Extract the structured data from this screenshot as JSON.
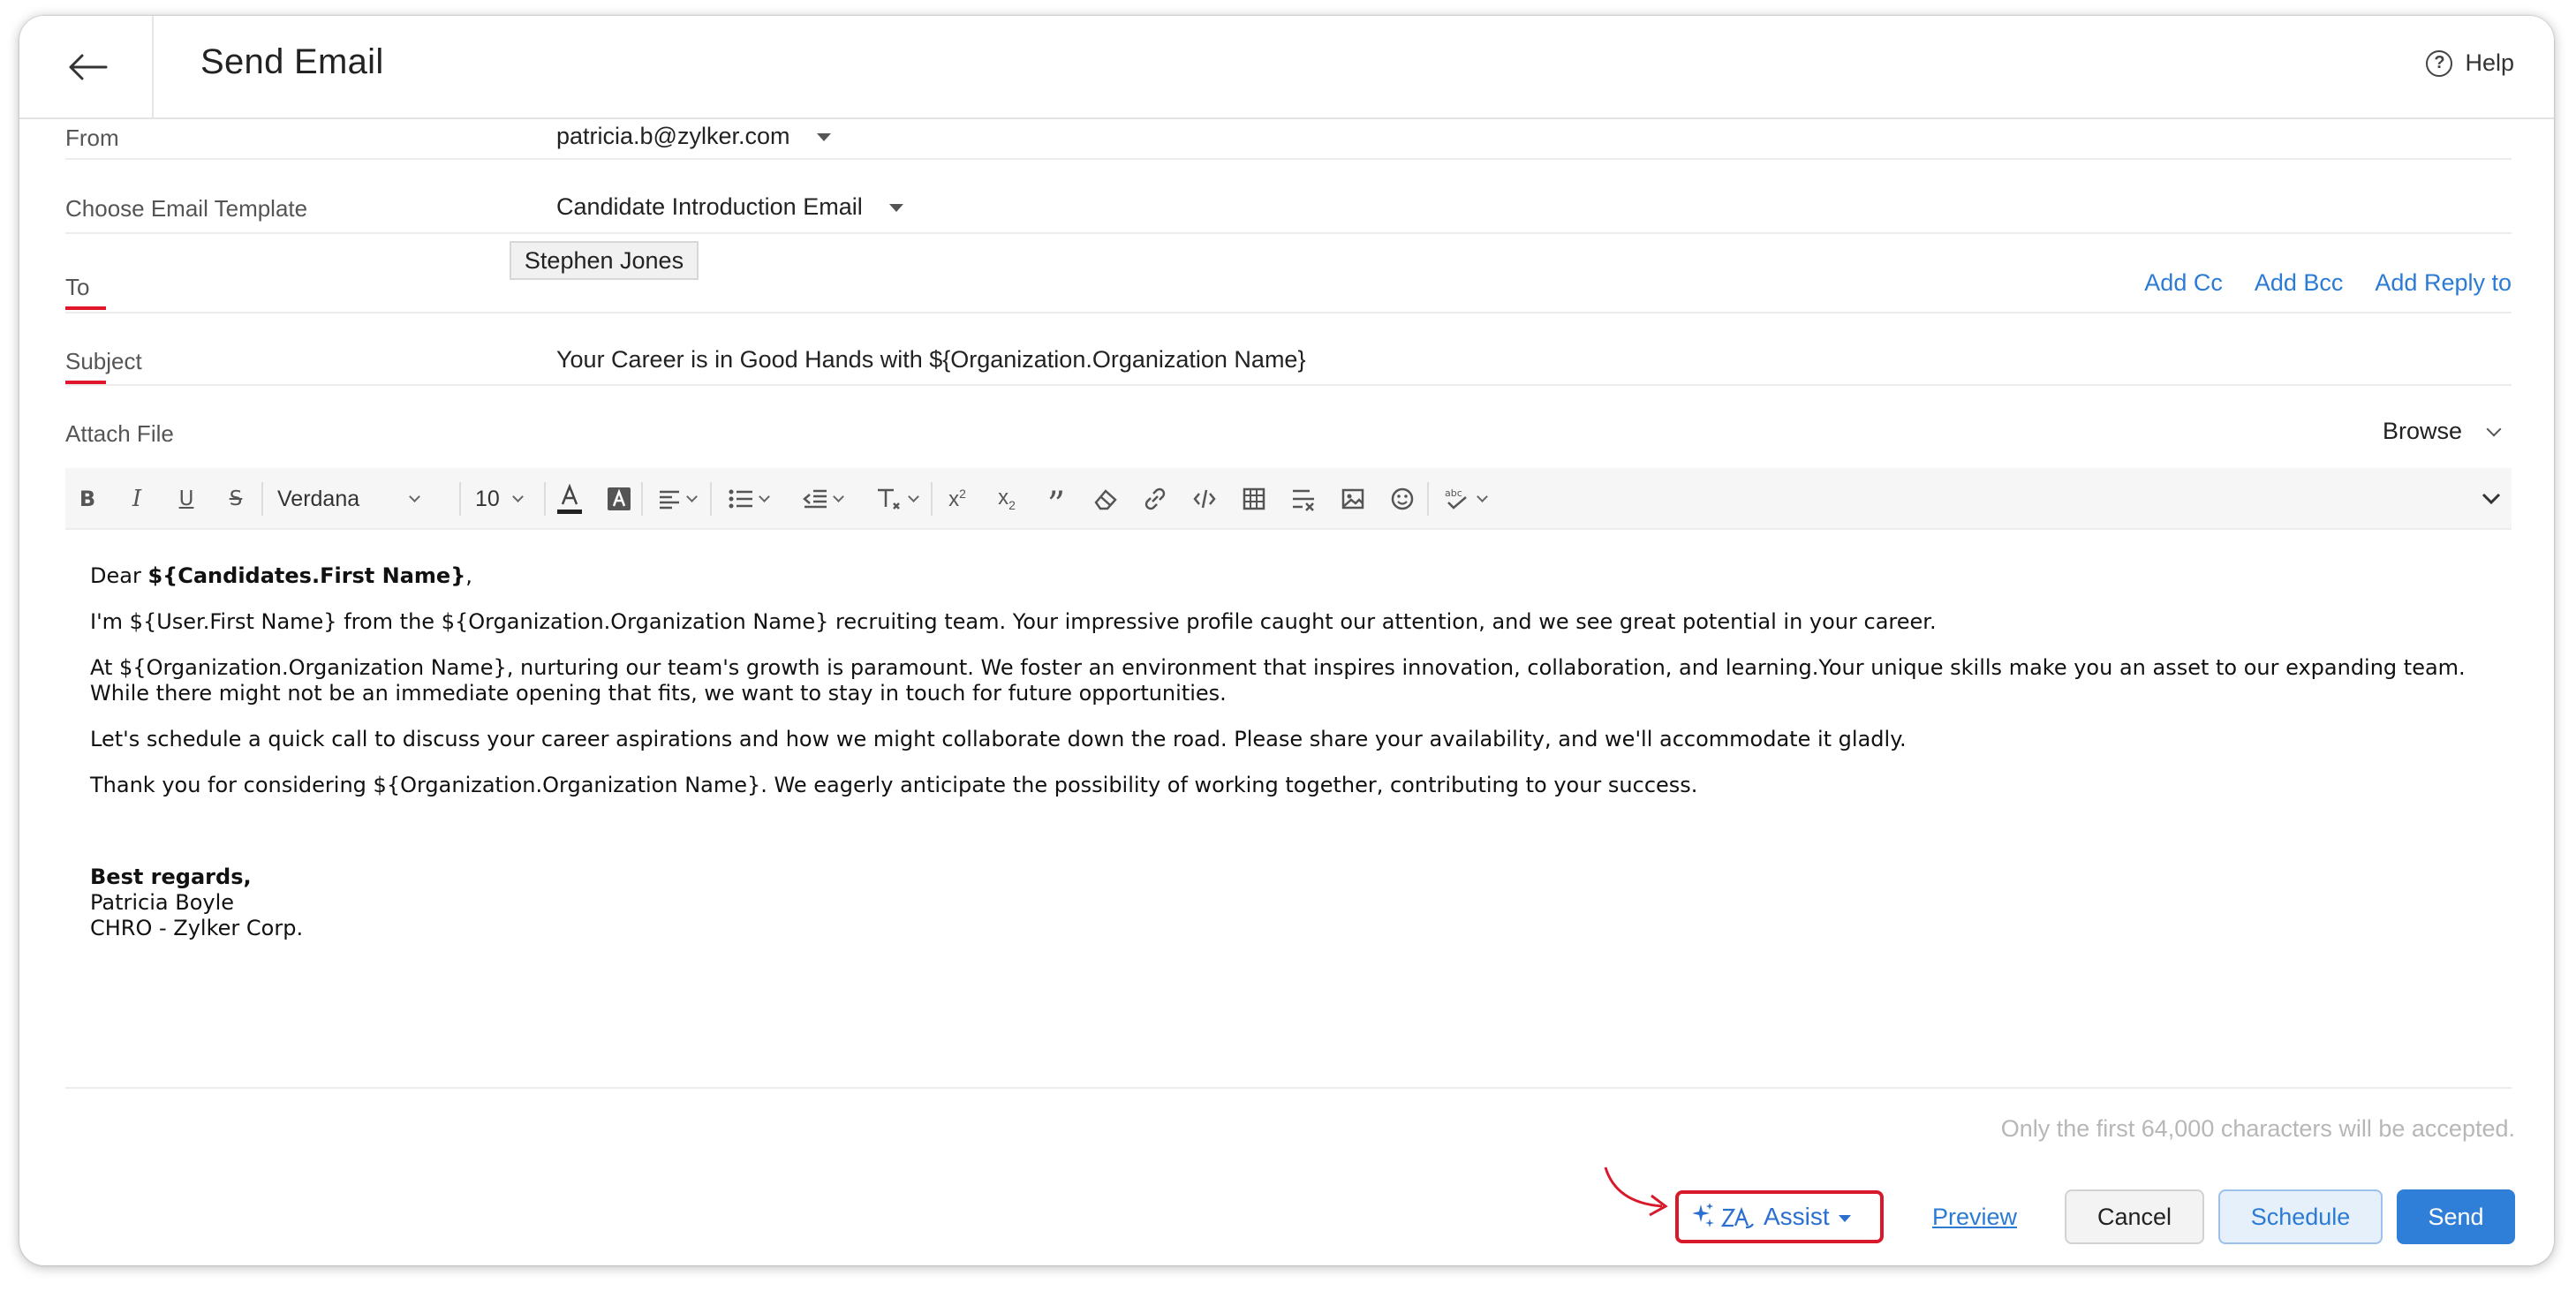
{
  "header": {
    "title": "Send Email",
    "help_label": "Help"
  },
  "form": {
    "from": {
      "label": "From",
      "value": "patricia.b@zylker.com"
    },
    "template": {
      "label": "Choose Email Template",
      "value": "Candidate Introduction Email"
    },
    "to": {
      "label": "To",
      "recipient": "Stephen Jones",
      "add_cc": "Add Cc",
      "add_bcc": "Add Bcc",
      "add_reply_to": "Add Reply to"
    },
    "subject": {
      "label": "Subject",
      "value": "Your Career is in Good Hands with ${Organization.Organization Name}"
    },
    "attach": {
      "label": "Attach File",
      "browse": "Browse"
    }
  },
  "toolbar": {
    "font": "Verdana",
    "size": "10"
  },
  "body": {
    "greeting_prefix": "Dear ",
    "greeting_name": "${Candidates.First Name}",
    "greeting_suffix": ",",
    "p1": "I'm ${User.First Name} from the ${Organization.Organization Name} recruiting team. Your impressive profile caught our attention, and we see great potential in your career.",
    "p2_line1": "At ${Organization.Organization Name}, nurturing our team's growth is paramount. We foster an environment that inspires innovation, collaboration, and learning.Your unique skills make you an asset to our expanding team.",
    "p2_line2": "While there might not be an immediate opening that fits, we want to stay in touch for future opportunities.",
    "p3": "Let's schedule a quick call to discuss your career aspirations and how we might collaborate down the road. Please share your availability, and we'll accommodate it gladly.",
    "p4": "Thank you for considering ${Organization.Organization Name}. We eagerly anticipate the possibility of working together, contributing to your success.",
    "sign_off": "Best regards,",
    "sender_name": "Patricia Boyle",
    "sender_title": "CHRO - Zylker Corp."
  },
  "footer": {
    "limit_note": "Only the first 64,000 characters will be accepted.",
    "assist": "Assist",
    "preview": "Preview",
    "cancel": "Cancel",
    "schedule": "Schedule",
    "send": "Send"
  },
  "colors": {
    "accent": "#2f7fd8",
    "required": "#e0162b",
    "highlight_box": "#d8192b"
  }
}
